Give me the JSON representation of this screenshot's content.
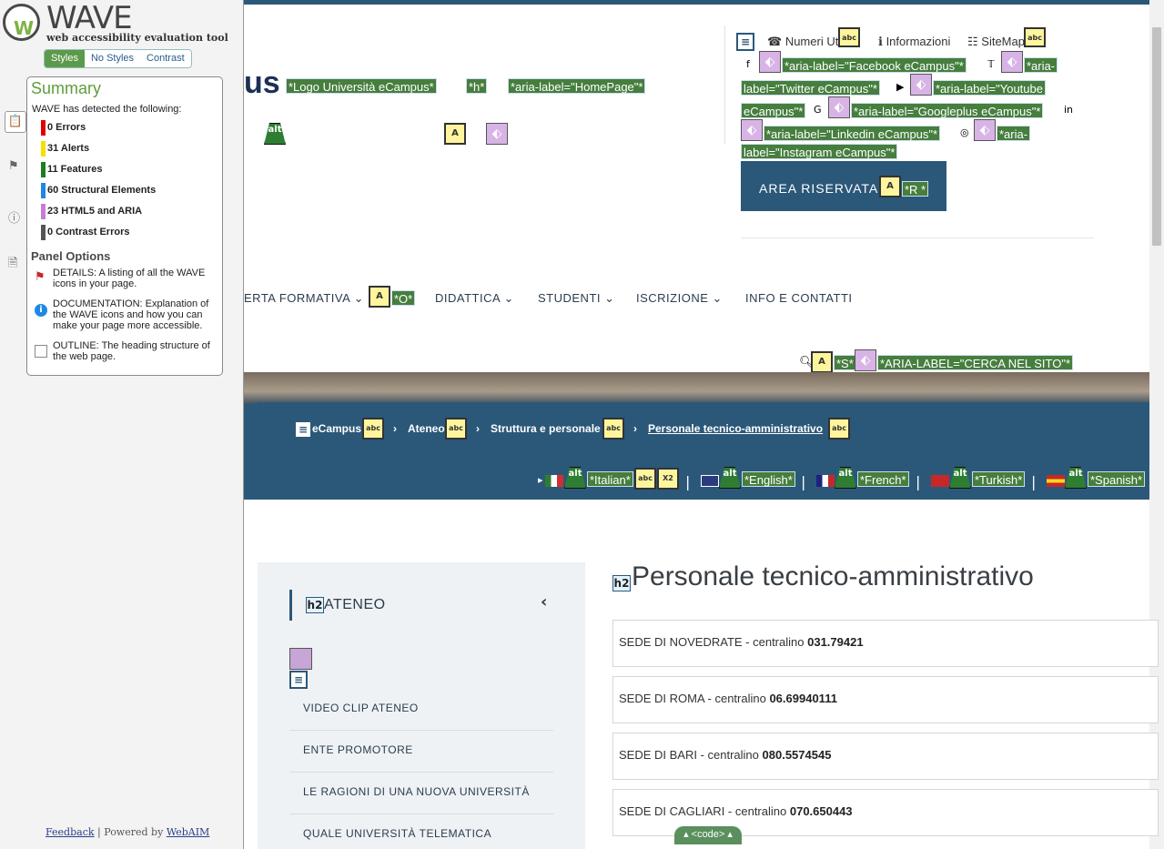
{
  "wave": {
    "logo": "WAVE",
    "tagline": "web accessibility evaluation tool",
    "tabs": [
      "Styles",
      "No Styles",
      "Contrast"
    ],
    "summary_title": "Summary",
    "detected": "WAVE has detected the following:",
    "counts": [
      {
        "label": "0 Errors",
        "color": "#e00000"
      },
      {
        "label": "31 Alerts",
        "color": "#f5e100"
      },
      {
        "label": "11 Features",
        "color": "#1b7f1b"
      },
      {
        "label": "60 Structural Elements",
        "color": "#1e88e5"
      },
      {
        "label": "23 HTML5 and ARIA",
        "color": "#c77dd3"
      },
      {
        "label": "0 Contrast Errors",
        "color": "#555555"
      }
    ],
    "panel_options": "Panel Options",
    "options": [
      {
        "label": "DETAILS: A listing of all the WAVE icons in your page.",
        "icon": "flag-icon"
      },
      {
        "label": "DOCUMENTATION: Explanation of the WAVE icons and how you can make your page more accessible.",
        "icon": "info-icon"
      },
      {
        "label": "OUTLINE: The heading structure of the web page.",
        "icon": "document-icon"
      }
    ],
    "feedback": "Feedback",
    "powered": "| Powered by",
    "webaim": "WebAIM"
  },
  "header": {
    "logo_tail": "us",
    "labels": {
      "logo_alt": "*Logo Università eCampus*",
      "h": "*h*",
      "homepage": "*aria-label=\"HomePage\"*"
    },
    "util": {
      "numeri": "Numeri Utili",
      "informazioni": "Informazioni",
      "sitemap": "SiteMap"
    },
    "social": {
      "facebook": "*aria-label=\"Facebook eCampus\"*",
      "twitter_1": "*aria-",
      "twitter_2": "label=\"Twitter eCampus\"*",
      "youtube_1": "*aria-label=\"Youtube",
      "youtube_2": "eCampus\"*",
      "googleplus": "*aria-label=\"Googleplus eCampus\"*",
      "linkedin": "*aria-label=\"Linkedin eCampus\"*",
      "instagram_1": "*aria-",
      "instagram_2": "label=\"Instagram eCampus\"*"
    },
    "area_riservata": "AREA RISERVATA",
    "r_label": "*R *"
  },
  "nav": {
    "items": [
      "ERTA FORMATIVA",
      "DIDATTICA",
      "STUDENTI",
      "ISCRIZIONE",
      "INFO E CONTATTI"
    ],
    "o_label": "*O*",
    "s_label": "*S*",
    "search_label": "*ARIA-LABEL=\"CERCA NEL SITO\"*"
  },
  "breadcrumb": [
    "eCampus",
    "Ateneo",
    "Struttura e personale",
    "Personale tecnico-amministrativo"
  ],
  "languages": [
    "*Italian*",
    "*English*",
    "*French*",
    "*Turkish*",
    "*Spanish*"
  ],
  "sidebar_menu": {
    "title": "ATENEO",
    "items": [
      "VIDEO CLIP ATENEO",
      "ENTE PROMOTORE",
      "LE RAGIONI DI UNA NUOVA UNIVERSITÀ",
      "QUALE UNIVERSITÀ TELEMATICA"
    ]
  },
  "content": {
    "heading": "Personale tecnico-amministrativo",
    "sedi": [
      {
        "label": "SEDE DI NOVEDRATE - centralino",
        "number": "031.79421"
      },
      {
        "label": "SEDE DI ROMA - centralino",
        "number": "06.69940111"
      },
      {
        "label": "SEDE DI BARI - centralino",
        "number": "080.5574545"
      },
      {
        "label": "SEDE DI CAGLIARI - centralino",
        "number": "070.650443"
      }
    ]
  },
  "code_toggle": "<code>"
}
